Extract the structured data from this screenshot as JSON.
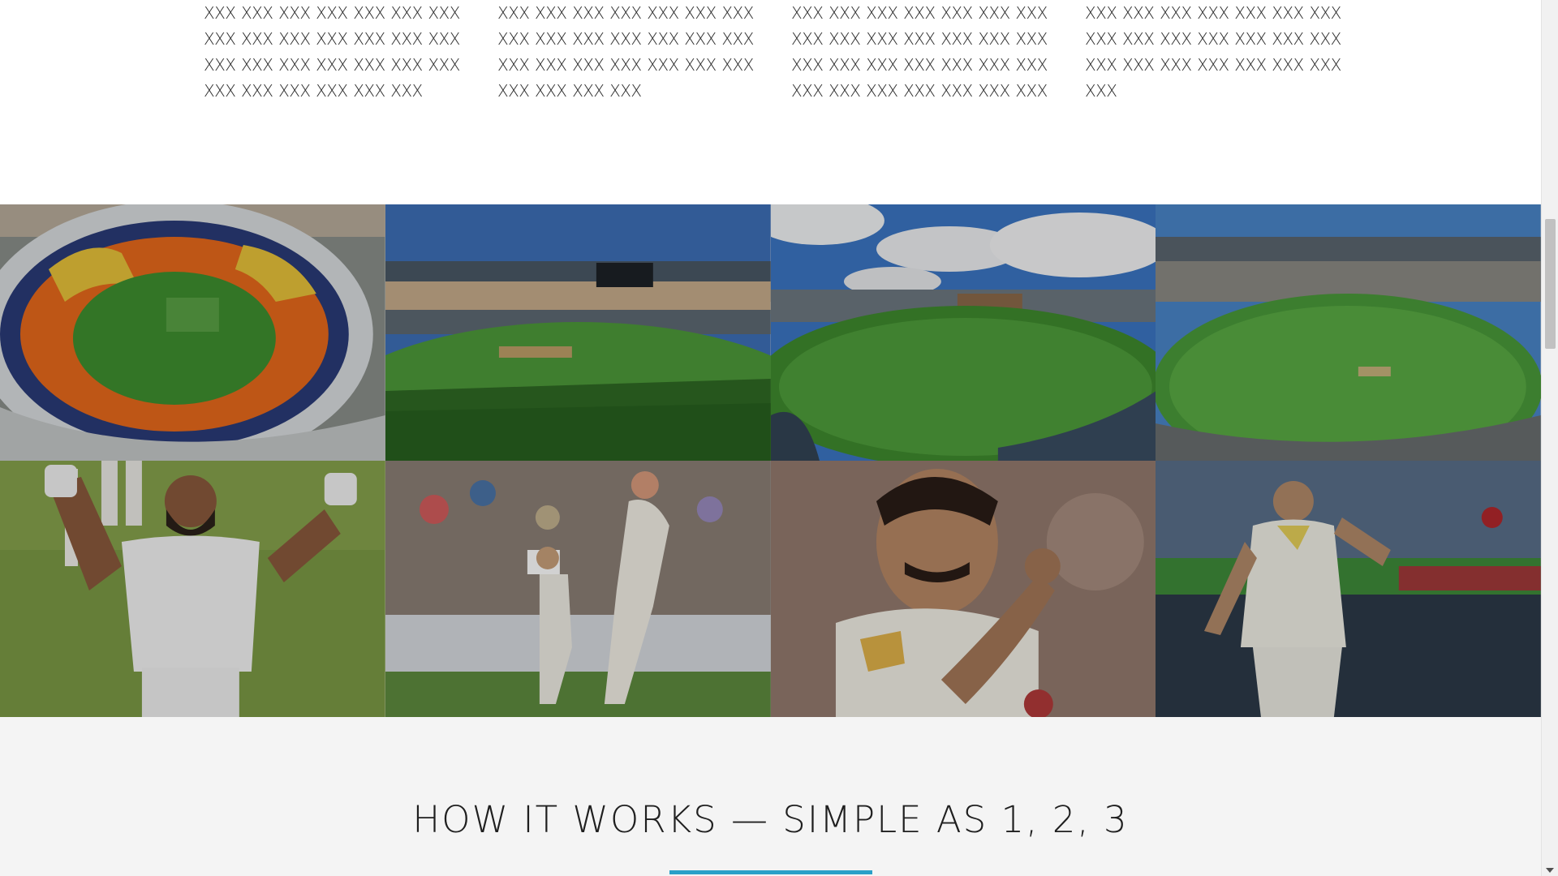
{
  "features": {
    "columns": [
      {
        "lines": [
          "XXX XXX XXX XXX XXX XXX XXX",
          "XXX XXX XXX XXX XXX XXX XXX",
          "XXX XXX XXX XXX XXX XXX XXX",
          "XXX XXX XXX XXX XXX XXX"
        ]
      },
      {
        "lines": [
          "XXX XXX XXX XXX XXX XXX XXX",
          "XXX XXX XXX XXX XXX XXX XXX",
          "XXX XXX XXX XXX XXX XXX XXX",
          "XXX XXX XXX XXX"
        ]
      },
      {
        "lines": [
          "XXX XXX XXX XXX XXX XXX XXX",
          "XXX XXX XXX XXX XXX XXX XXX",
          "XXX XXX XXX XXX XXX XXX XXX",
          "XXX XXX XXX XXX XXX XXX XXX"
        ]
      },
      {
        "lines": [
          "XXX XXX XXX XXX XXX XXX XXX",
          "XXX XXX XXX XXX XXX XXX XXX",
          "XXX XXX XXX XXX XXX XXX XXX",
          "XXX"
        ]
      }
    ]
  },
  "gallery": {
    "images": [
      {
        "name": "stadium-aerial-photo"
      },
      {
        "name": "stadium-mcg-photo"
      },
      {
        "name": "stadium-oval-photo"
      },
      {
        "name": "stadium-crowd-photo"
      },
      {
        "name": "batsman-celebrating-photo"
      },
      {
        "name": "batsman-shot-photo"
      },
      {
        "name": "bowler-closeup-photo"
      },
      {
        "name": "bowler-walking-photo"
      }
    ]
  },
  "how_it_works": {
    "title": "HOW IT WORKS — SIMPLE AS 1, 2, 3"
  },
  "colors": {
    "accent": "#2aa0c8",
    "section_bg": "#f4f4f4"
  }
}
